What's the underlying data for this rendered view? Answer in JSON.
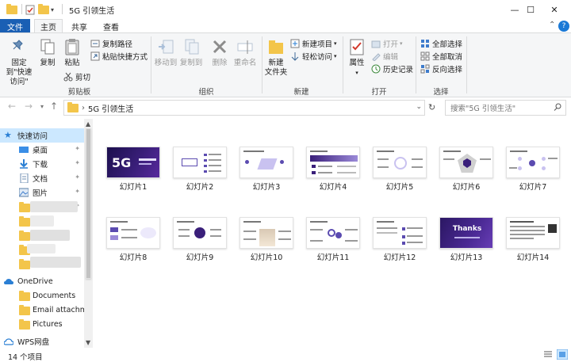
{
  "window": {
    "title": "5G 引领生活",
    "minimize": "—",
    "maximize": "☐",
    "close": "✕"
  },
  "ribbon_tabs": [
    {
      "label": "文件"
    },
    {
      "label": "主页"
    },
    {
      "label": "共享"
    },
    {
      "label": "查看"
    }
  ],
  "ribbon": {
    "pin_quick_access": "固定到\"快速访问\"",
    "copy": "复制",
    "paste": "粘贴",
    "copy_path": "复制路径",
    "paste_shortcut": "粘贴快捷方式",
    "cut": "剪切",
    "clipboard_group": "剪贴板",
    "move_to": "移动到",
    "copy_to": "复制到",
    "delete": "删除",
    "rename": "重命名",
    "organize_group": "组织",
    "new_item": "新建项目",
    "easy_access": "轻松访问",
    "new_folder": "新建\n文件夹",
    "new_group": "新建",
    "properties": "属性",
    "open": "打开",
    "edit": "编辑",
    "history": "历史记录",
    "open_group": "打开",
    "select_all": "全部选择",
    "select_none": "全部取消",
    "invert_selection": "反向选择",
    "select_group": "选择"
  },
  "address": {
    "path": "5G 引领生活",
    "search_placeholder": "搜索\"5G 引领生活\""
  },
  "nav": {
    "quick_access": "快速访问",
    "desktop": "桌面",
    "downloads": "下载",
    "documents": "文档",
    "pictures": "图片",
    "onedrive": "OneDrive",
    "od_documents": "Documents",
    "od_email": "Email attachme",
    "od_pictures": "Pictures",
    "wps": "WPS网盘"
  },
  "files": [
    {
      "name": "幻灯片1"
    },
    {
      "name": "幻灯片2"
    },
    {
      "name": "幻灯片3"
    },
    {
      "name": "幻灯片4"
    },
    {
      "name": "幻灯片5"
    },
    {
      "name": "幻灯片6"
    },
    {
      "name": "幻灯片7"
    },
    {
      "name": "幻灯片8"
    },
    {
      "name": "幻灯片9"
    },
    {
      "name": "幻灯片10"
    },
    {
      "name": "幻灯片11"
    },
    {
      "name": "幻灯片12"
    },
    {
      "name": "幻灯片13"
    },
    {
      "name": "幻灯片14"
    }
  ],
  "thumb_text": {
    "slide1": "5G",
    "slide13": "Thanks"
  },
  "status": {
    "count": "14 个项目"
  },
  "colors": {
    "accent": "#1a5fb4",
    "folder": "#f3c54a",
    "selection": "#cce8ff",
    "slide_purple": "#3a1f7a"
  }
}
